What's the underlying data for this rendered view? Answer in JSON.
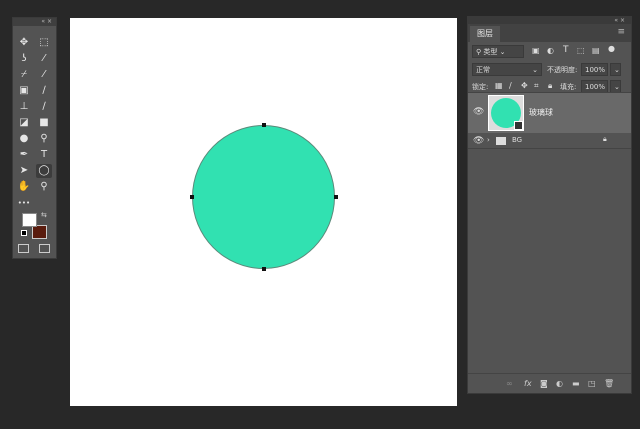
{
  "toolbar": {
    "collapse_label": "« ×",
    "tools": [
      {
        "name": "move-tool",
        "glyph": "✥"
      },
      {
        "name": "marquee-tool",
        "glyph": "⬚"
      },
      {
        "name": "lasso-tool",
        "glyph": "ʖ"
      },
      {
        "name": "magic-wand-tool",
        "glyph": "⁄"
      },
      {
        "name": "crop-tool",
        "glyph": "⌿"
      },
      {
        "name": "eyedropper-tool",
        "glyph": "⁄"
      },
      {
        "name": "healing-tool",
        "glyph": "▣"
      },
      {
        "name": "brush-tool",
        "glyph": "∕"
      },
      {
        "name": "stamp-tool",
        "glyph": "⊥"
      },
      {
        "name": "history-brush-tool",
        "glyph": "∕"
      },
      {
        "name": "eraser-tool",
        "glyph": "◪"
      },
      {
        "name": "gradient-tool",
        "glyph": "■"
      },
      {
        "name": "blur-tool",
        "glyph": "●"
      },
      {
        "name": "dodge-tool",
        "glyph": "⚲"
      },
      {
        "name": "pen-tool",
        "glyph": "✒"
      },
      {
        "name": "type-tool",
        "glyph": "T"
      },
      {
        "name": "path-selection-tool",
        "glyph": "➤"
      },
      {
        "name": "ellipse-tool",
        "glyph": "◯"
      },
      {
        "name": "hand-tool",
        "glyph": "✋"
      },
      {
        "name": "zoom-tool",
        "glyph": "⚲"
      },
      {
        "name": "more-tools",
        "glyph": "•••"
      }
    ],
    "foreground_color": "#ffffff",
    "background_color": "#5a1c0e"
  },
  "canvas": {
    "shape_color": "#31e1b1",
    "background": "#ffffff"
  },
  "panel": {
    "collapse_label": "« ×",
    "tab": "图层",
    "menu_icon": "≡",
    "filter_kind": "类型",
    "blend_mode": "正常",
    "opacity_label": "不透明度:",
    "opacity_value": "100%",
    "lock_label": "锁定:",
    "fill_label": "填充:",
    "fill_value": "100%",
    "layers": [
      {
        "name": "玻璃球",
        "visible": true,
        "selected": true
      },
      {
        "name": "BG",
        "visible": true,
        "type": "group",
        "locked": true
      }
    ],
    "bottom_icons": [
      "link-icon",
      "fx-icon",
      "mask-icon",
      "adjustment-icon",
      "folder-icon",
      "new-layer-icon",
      "trash-icon"
    ],
    "fx_label": "fx"
  }
}
